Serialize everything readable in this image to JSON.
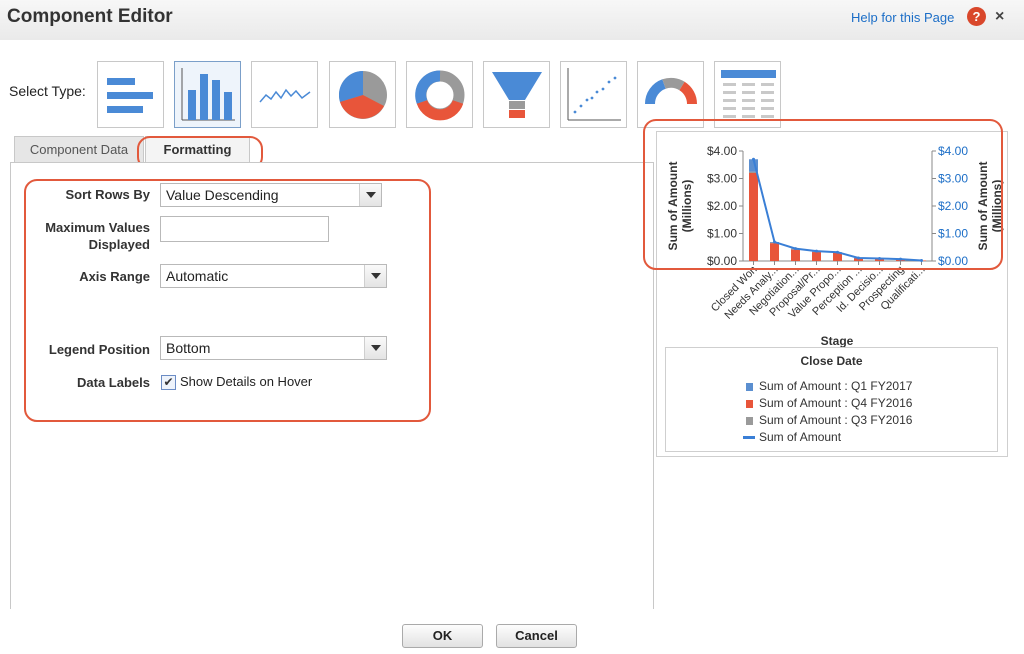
{
  "header": {
    "title": "Component Editor",
    "help_link": "Help for this Page",
    "help_icon_glyph": "?",
    "close_glyph": "×"
  },
  "select_type": {
    "label": "Select Type:",
    "types": [
      {
        "name": "horizontal-bar-chart",
        "selected": false
      },
      {
        "name": "vertical-bar-chart",
        "selected": true
      },
      {
        "name": "line-chart",
        "selected": false
      },
      {
        "name": "pie-chart",
        "selected": false
      },
      {
        "name": "donut-chart",
        "selected": false
      },
      {
        "name": "funnel-chart",
        "selected": false
      },
      {
        "name": "scatter-chart",
        "selected": false
      },
      {
        "name": "gauge-chart",
        "selected": false
      },
      {
        "name": "table",
        "selected": false
      }
    ]
  },
  "tabs": [
    {
      "label": "Component Data",
      "active": false
    },
    {
      "label": "Formatting",
      "active": true
    }
  ],
  "form": {
    "sort_rows_label": "Sort Rows By",
    "sort_rows_value": "Value Descending",
    "max_values_label_line1": "Maximum Values",
    "max_values_label_line2": "Displayed",
    "max_values_value": "",
    "axis_range_label": "Axis Range",
    "axis_range_value": "Automatic",
    "legend_position_label": "Legend Position",
    "legend_position_value": "Bottom",
    "data_labels_label": "Data Labels",
    "show_details_checked": true,
    "show_details_label": "Show Details on Hover",
    "check_glyph": "✔"
  },
  "buttons": {
    "ok": "OK",
    "cancel": "Cancel"
  },
  "colors": {
    "accent_annotation": "#e2593c",
    "q1_fy2017": "#5b8fd0",
    "q4_fy2016": "#e8553a",
    "q3_fy2016": "#9a9a9a",
    "line": "#3a7fd6",
    "link": "#1c6ec7"
  },
  "chart_data": {
    "type": "bar",
    "stacked": true,
    "categories": [
      "Closed Won",
      "Needs Analy...",
      "Negotiation...",
      "Proposal/Pr...",
      "Value Propo...",
      "Perception ...",
      "Id. Decisio...",
      "Prospecting",
      "Qualificati..."
    ],
    "series": [
      {
        "name": "Sum of Amount : Q1 FY2017",
        "values": [
          0.45,
          0.02,
          0.02,
          0.02,
          0.01,
          0.01,
          0.01,
          0.01,
          0.0
        ]
      },
      {
        "name": "Sum of Amount : Q4 FY2016",
        "values": [
          3.2,
          0.65,
          0.42,
          0.33,
          0.3,
          0.1,
          0.08,
          0.06,
          0.02
        ]
      },
      {
        "name": "Sum of Amount : Q3 FY2016",
        "values": [
          0.05,
          0.02,
          0.01,
          0.01,
          0.01,
          0.0,
          0.0,
          0.0,
          0.0
        ]
      }
    ],
    "line_series": {
      "name": "Sum of Amount",
      "values": [
        3.7,
        0.69,
        0.45,
        0.36,
        0.32,
        0.11,
        0.09,
        0.07,
        0.02
      ]
    },
    "xlabel": "Stage",
    "ylabel_left": "Sum of Amount (Millions)",
    "ylabel_right": "Sum of Amount (Millions)",
    "yticks": [
      "$0.00",
      "$1.00",
      "$2.00",
      "$3.00",
      "$4.00"
    ],
    "ylim": [
      0,
      4
    ],
    "legend_title": "Close Date",
    "legend_position": "bottom",
    "grid": false
  }
}
